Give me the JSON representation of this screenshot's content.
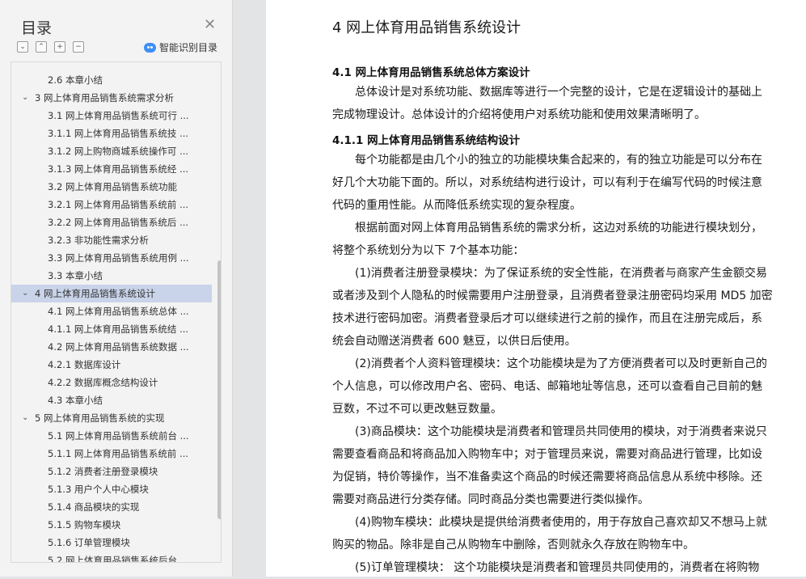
{
  "sidebar": {
    "title": "目录",
    "smart_toc_label": "智能识别目录",
    "tool_icons": [
      "collapse-all-icon",
      "expand-up-icon",
      "add-heading-icon",
      "remove-heading-icon"
    ],
    "items": [
      {
        "label": "2.6 本章小结",
        "level": 2
      },
      {
        "label": "3 网上体育用品销售系统需求分析",
        "level": 1
      },
      {
        "label": "3.1 网上体育用品销售系统可行 ...",
        "level": 2
      },
      {
        "label": "3.1.1 网上体育用品销售系统技 ...",
        "level": 2
      },
      {
        "label": "3.1.2 网上购物商城系统操作可 ...",
        "level": 2
      },
      {
        "label": "3.1.3 网上体育用品销售系统经 ...",
        "level": 2
      },
      {
        "label": "3.2 网上体育用品销售系统功能",
        "level": 2
      },
      {
        "label": "3.2.1 网上体育用品销售系统前 ...",
        "level": 2
      },
      {
        "label": "3.2.2 网上体育用品销售系统后 ...",
        "level": 2
      },
      {
        "label": "3.2.3 非功能性需求分析",
        "level": 2
      },
      {
        "label": "3.3 网上体育用品销售系统用例 ...",
        "level": 2
      },
      {
        "label": "3.3 本章小结",
        "level": 2
      },
      {
        "label": "4 网上体育用品销售系统设计",
        "level": 1,
        "selected": true
      },
      {
        "label": "4.1 网上体育用品销售系统总体 ...",
        "level": 2
      },
      {
        "label": "4.1.1 网上体育用品销售系统结 ...",
        "level": 2
      },
      {
        "label": "4.2 网上体育用品销售系统数据 ...",
        "level": 2
      },
      {
        "label": "4.2.1 数据库设计",
        "level": 2
      },
      {
        "label": "4.2.2 数据库概念结构设计",
        "level": 2
      },
      {
        "label": "4.3 本章小结",
        "level": 2
      },
      {
        "label": "5 网上体育用品销售系统的实现",
        "level": 1
      },
      {
        "label": "5.1 网上体育用品销售系统前台 ...",
        "level": 2
      },
      {
        "label": "5.1.1 网上体育用品销售系统前 ...",
        "level": 2
      },
      {
        "label": "5.1.2 消费者注册登录模块",
        "level": 2
      },
      {
        "label": "5.1.3 用户个人中心模块",
        "level": 2
      },
      {
        "label": "5.1.4 商品模块的实现",
        "level": 2
      },
      {
        "label": "5.1.5 购物车模块",
        "level": 2
      },
      {
        "label": "5.1.6 订单管理模块",
        "level": 2
      },
      {
        "label": "5.2 网上体育用品销售系统后台 ...",
        "level": 2
      }
    ]
  },
  "document": {
    "chapter_title": "4 网上体育用品销售系统设计",
    "h_4_1": "4.1 网上体育用品销售系统总体方案设计",
    "p1": [
      "总体设计是对系统功能、数据库等进行一个完整的设计，它是在逻辑设计的基础上",
      "完成物理设计。总体设计的介绍将使用户对系统功能和使用效果清晰明了。"
    ],
    "h_4_1_1": "4.1.1 网上体育用品销售系统结构设计",
    "p2": [
      "每个功能都是由几个小的独立的功能模块集合起来的，有的独立功能是可以分布在",
      "好几个大功能下面的。所以，对系统结构进行设计，可以有利于在编写代码的时候注意",
      "代码的重用性能。从而降低系统实现的复杂程度。"
    ],
    "p3": [
      "根据前面对网上体育用品销售系统的需求分析，这边对系统的功能进行模块划分，",
      "将整个系统划分为以下 7个基本功能："
    ],
    "p4": [
      "(1)消费者注册登录模块：为了保证系统的安全性能，在消费者与商家产生金额交易",
      "或者涉及到个人隐私的时候需要用户注册登录，且消费者登录注册密码均采用 MD5 加密",
      "技术进行密码加密。消费者登录后才可以继续进行之前的操作，而且在注册完成后，系",
      "统会自动赠送消费者 600 魅豆，以供日后使用。"
    ],
    "p5": [
      "(2)消费者个人资料管理模块：这个功能模块是为了方便消费者可以及时更新自己的",
      "个人信息，可以修改用户名、密码、电话、邮箱地址等信息，还可以查看自己目前的魅",
      "豆数，不过不可以更改魅豆数量。"
    ],
    "p6": [
      "(3)商品模块：这个功能模块是消费者和管理员共同使用的模块，对于消费者来说只",
      "需要查看商品和将商品加入购物车中；对于管理员来说，需要对商品进行管理，比如设",
      "为促销，特价等操作，当不准备卖这个商品的时候还需要将商品信息从系统中移除。还",
      "需要对商品进行分类存储。同时商品分类也需要进行类似操作。"
    ],
    "p7": [
      "(4)购物车模块：此模块是提供给消费者使用的，用于存放自己喜欢却又不想马上就",
      "购买的物品。除非是自己从购物车中删除，否则就永久存放在购物车中。"
    ],
    "p8": [
      "(5)订单管理模块：  这个功能模块是消费者和管理员共同使用的，消费者在将购物"
    ]
  }
}
